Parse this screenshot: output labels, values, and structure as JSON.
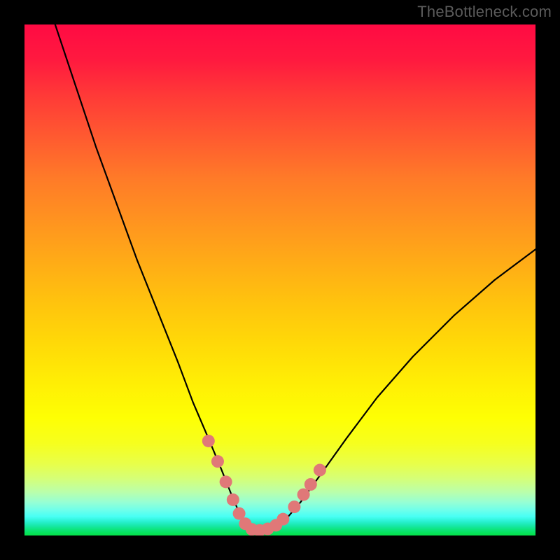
{
  "watermark": "TheBottleneck.com",
  "chart_data": {
    "type": "line",
    "title": "",
    "xlabel": "",
    "ylabel": "",
    "xlim": [
      0,
      100
    ],
    "ylim": [
      0,
      100
    ],
    "series": [
      {
        "name": "bottleneck-curve",
        "x": [
          6,
          10,
          14,
          18,
          22,
          26,
          30,
          33,
          36,
          38.5,
          40.5,
          42,
          43.5,
          45,
          47,
          49,
          51,
          54,
          58,
          63,
          69,
          76,
          84,
          92,
          100
        ],
        "y": [
          100,
          88,
          76,
          65,
          54,
          44,
          34,
          26,
          19,
          13,
          8,
          4.5,
          2,
          1,
          1,
          1.5,
          3,
          6.5,
          12,
          19,
          27,
          35,
          43,
          50,
          56
        ]
      }
    ],
    "markers": {
      "name": "optimum-points",
      "color": "#e07878",
      "points": [
        {
          "x": 36.0,
          "y": 18.5
        },
        {
          "x": 37.8,
          "y": 14.5
        },
        {
          "x": 39.4,
          "y": 10.5
        },
        {
          "x": 40.8,
          "y": 7.0
        },
        {
          "x": 42.0,
          "y": 4.3
        },
        {
          "x": 43.2,
          "y": 2.3
        },
        {
          "x": 44.5,
          "y": 1.2
        },
        {
          "x": 46.0,
          "y": 1.0
        },
        {
          "x": 47.6,
          "y": 1.3
        },
        {
          "x": 49.2,
          "y": 2.0
        },
        {
          "x": 50.6,
          "y": 3.2
        },
        {
          "x": 52.8,
          "y": 5.6
        },
        {
          "x": 54.6,
          "y": 8.0
        },
        {
          "x": 56.0,
          "y": 10.0
        },
        {
          "x": 57.8,
          "y": 12.8
        }
      ]
    },
    "gradient_stops": [
      {
        "pos": 0.0,
        "color": "#ff0a43"
      },
      {
        "pos": 0.5,
        "color": "#ffc20e"
      },
      {
        "pos": 0.8,
        "color": "#feff04"
      },
      {
        "pos": 1.0,
        "color": "#04e24a"
      }
    ]
  }
}
